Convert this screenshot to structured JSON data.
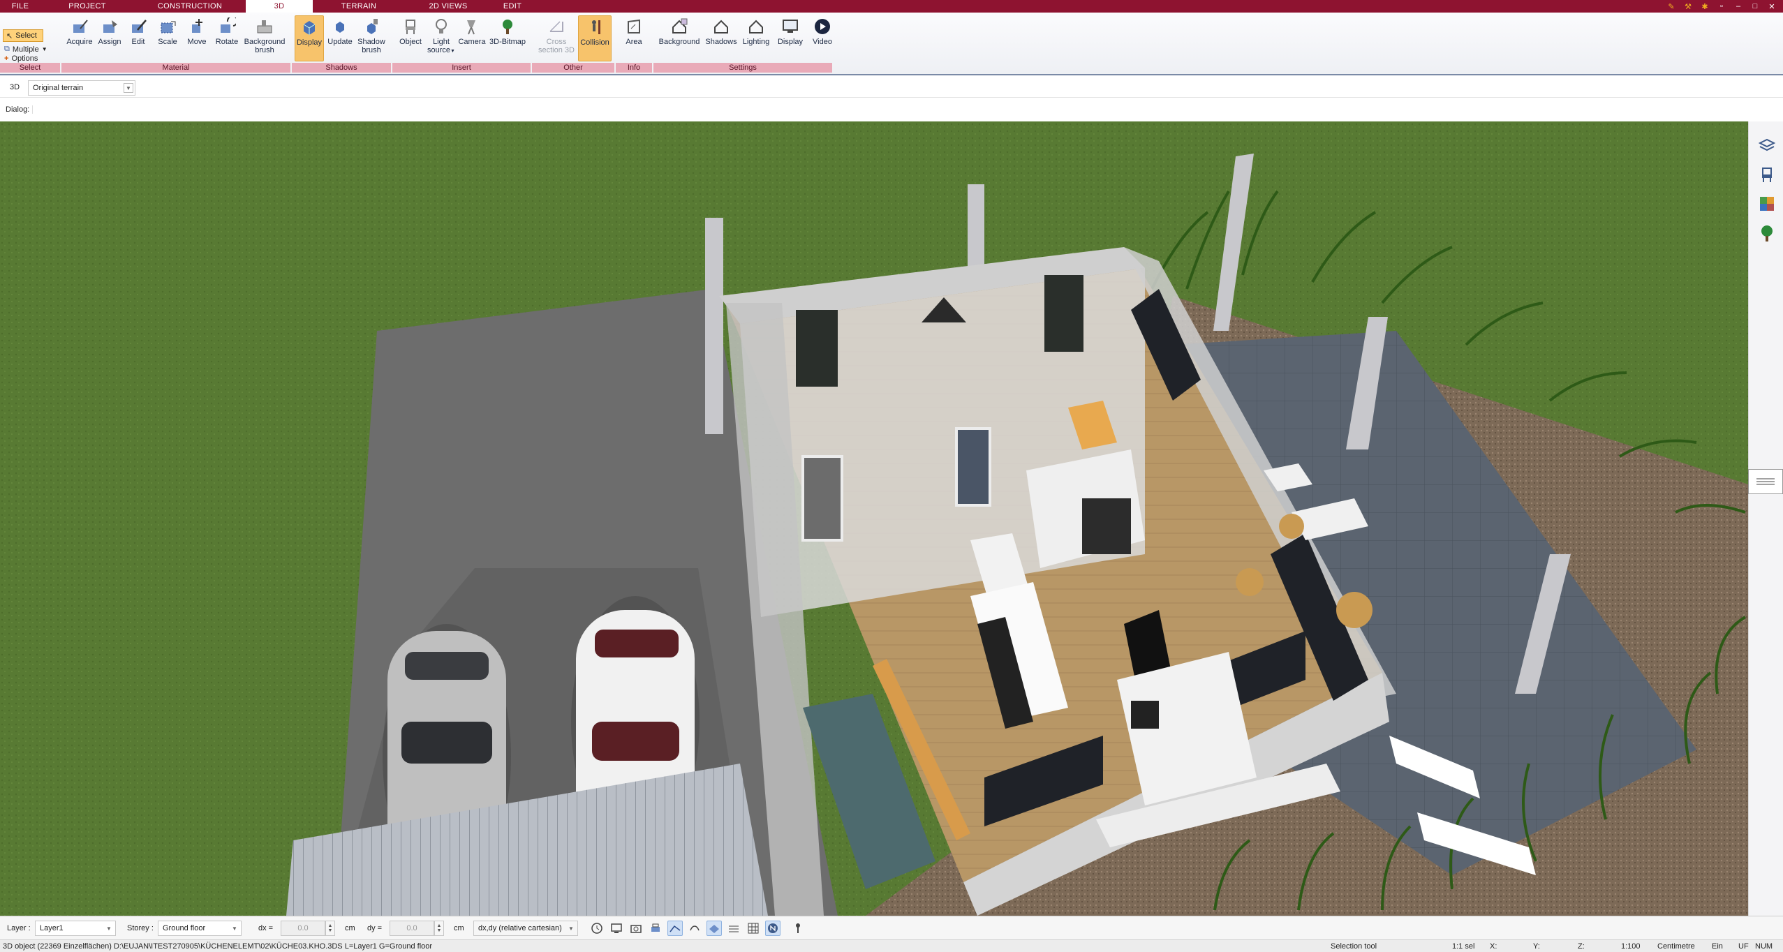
{
  "menu": {
    "tabs": [
      {
        "label": "FILE"
      },
      {
        "label": "PROJECT"
      },
      {
        "label": "CONSTRUCTION"
      },
      {
        "label": "3D"
      },
      {
        "label": "TERRAIN"
      },
      {
        "label": "2D VIEWS"
      },
      {
        "label": "EDIT"
      }
    ],
    "active_tab": "3D"
  },
  "window_controls": {
    "restore": "▫",
    "minimize": "–",
    "maximize": "□",
    "close": "✕"
  },
  "ribbon": {
    "select": {
      "select_label": "Select",
      "multiple_label": "Multiple",
      "options_label": "Options",
      "group_label": "Select"
    },
    "material": {
      "acquire": "Acquire",
      "assign": "Assign",
      "edit": "Edit",
      "scale": "Scale",
      "move": "Move",
      "rotate": "Rotate",
      "background_brush_1": "Background",
      "background_brush_2": "brush",
      "group_label": "Material"
    },
    "shadows": {
      "display": "Display",
      "update": "Update",
      "shadow_brush_1": "Shadow",
      "shadow_brush_2": "brush",
      "group_label": "Shadows"
    },
    "insert": {
      "object": "Object",
      "light_source_1": "Light",
      "light_source_2": "source",
      "camera": "Camera",
      "bitmap_3d": "3D-Bitmap",
      "group_label": "Insert"
    },
    "other": {
      "cross_section_1": "Cross",
      "cross_section_2": "section 3D",
      "collision": "Collision",
      "group_label": "Other"
    },
    "info": {
      "area": "Area",
      "group_label": "Info"
    },
    "settings": {
      "background": "Background",
      "shadows": "Shadows",
      "lighting": "Lighting",
      "display": "Display",
      "video": "Video",
      "group_label": "Settings"
    }
  },
  "viewbar": {
    "view_label": "3D",
    "terrain_value": "Original terrain"
  },
  "dialogbar": {
    "label": "Dialog:"
  },
  "bottombar": {
    "layer_label": "Layer :",
    "layer_value": "Layer1",
    "storey_label": "Storey :",
    "storey_value": "Ground floor",
    "dx_label": "dx =",
    "dx_value": "0.0",
    "dx_unit": "cm",
    "dy_label": "dy =",
    "dy_value": "0.0",
    "dy_unit": "cm",
    "coord_mode": "dx,dy (relative cartesian)"
  },
  "statusbar": {
    "object_info": "3D object (22369 Einzelflächen) D:\\EUJAN\\ITEST270905\\KÜCHENELEMT\\02\\KÜCHE03.KHO.3DS L=Layer1 G=Ground floor",
    "tool": "Selection tool",
    "selection": "1:1 sel",
    "x_label": "X:",
    "y_label": "Y:",
    "z_label": "Z:",
    "scale": "1:100",
    "unit": "Centimetre",
    "ein": "Ein",
    "uf": "UF",
    "num": "NUM"
  },
  "colors": {
    "brand": "#8e1330",
    "ribbon_group": "#e9aab8",
    "active_button": "#f7c36b"
  }
}
